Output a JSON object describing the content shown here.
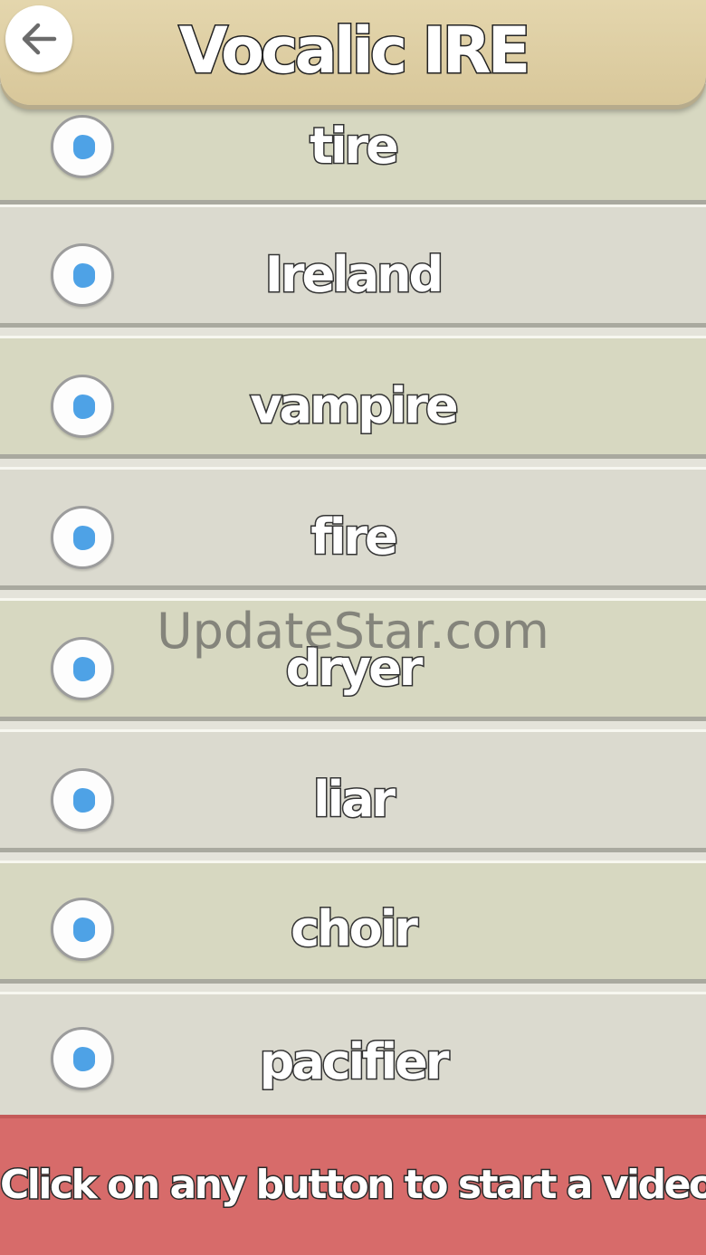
{
  "header": {
    "title": "Vocalic IRE",
    "back_icon": "arrow-left-icon"
  },
  "words": [
    {
      "label": "tire",
      "tone": "green"
    },
    {
      "label": "Ireland",
      "tone": "gray"
    },
    {
      "label": "vampire",
      "tone": "green"
    },
    {
      "label": "fire",
      "tone": "gray"
    },
    {
      "label": "dryer",
      "tone": "green"
    },
    {
      "label": "liar",
      "tone": "gray"
    },
    {
      "label": "choir",
      "tone": "green"
    },
    {
      "label": "pacifier",
      "tone": "gray"
    }
  ],
  "play_icon": "play-icon",
  "watermark": "UpdateStar.com",
  "footer": {
    "text": "Click on any button to start a video"
  },
  "colors": {
    "header": "#d8c79a",
    "row_green": "#d7d8c1",
    "row_gray": "#dbdacf",
    "play_dot": "#4ea2e6",
    "footer": "#d76b6a"
  }
}
